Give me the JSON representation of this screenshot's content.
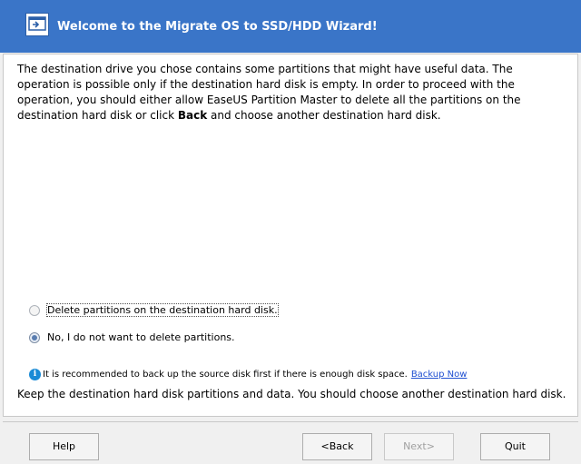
{
  "header": {
    "title": "Welcome to the Migrate OS to SSD/HDD Wizard!",
    "icon": "wizard-window-icon"
  },
  "content": {
    "desc_part1": "The destination drive you chose contains some partitions that might have useful data. The operation is possible only if the destination hard disk is empty. In order to proceed with the operation, you should either allow EaseUS Partition Master to delete all the partitions on the destination hard disk or click ",
    "desc_bold": "Back",
    "desc_part2": " and choose another destination hard disk.",
    "options": [
      {
        "label": "Delete partitions on the destination hard disk.",
        "checked": false
      },
      {
        "label": "No, I do not want to delete partitions.",
        "checked": true
      }
    ],
    "info_text": "It is recommended to back up the source disk first if there is enough disk space.",
    "backup_link": "Backup Now",
    "keep_text": "Keep the destination hard disk partitions and data. You should choose another destination hard disk."
  },
  "footer": {
    "help": "Help",
    "back": "<Back",
    "next": "Next>",
    "quit": "Quit"
  },
  "colors": {
    "header_bg": "#3a75c8",
    "link": "#1f4fd1",
    "info_icon": "#1a8bd6"
  }
}
